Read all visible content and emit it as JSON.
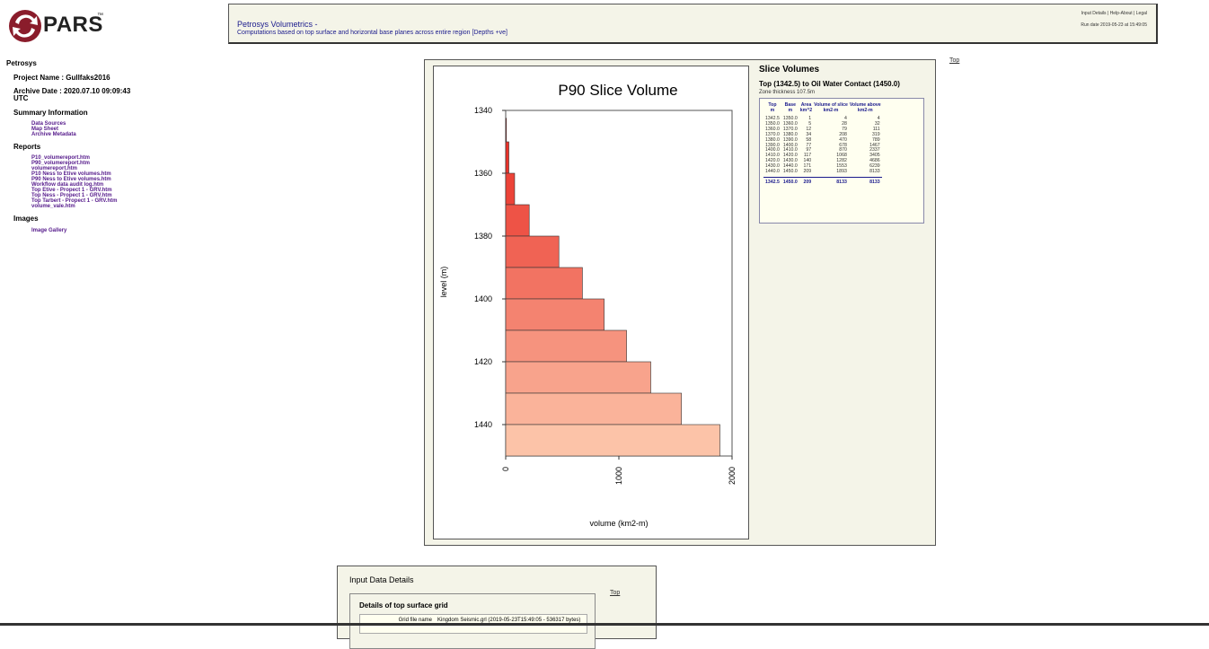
{
  "brand": {
    "name": "PARS",
    "tm": "™"
  },
  "sidebar": {
    "section_title": "Petrosys",
    "project_line": "Project Name : Gullfaks2016",
    "archive_line": "Archive Date : 2020.07.10 09:09:43",
    "archive_tz": "UTC",
    "summary_heading": "Summary Information",
    "summary_links": [
      "Data Sources",
      "Map Sheet",
      "Archive Metadata"
    ],
    "report_heading": "Reports",
    "report_links": [
      "P10_volumereport.htm",
      "P90_volumereport.htm",
      "volumereport.htm",
      "P10 Ness to Etive volumes.htm",
      "P90 Ness to Etive volumes.htm",
      "Workflow data audit log.htm",
      "Top Etive - Propect 1 - GRV.htm",
      "Top Ness - Propect 1 - GRV.htm",
      "Top Tarbert - Propect 1 - GRV.htm",
      "volume_vale.htm"
    ],
    "images_heading": "Images",
    "image_links": [
      "Image Gallery"
    ]
  },
  "header": {
    "title": "Petrosys Volumetrics -",
    "subtitle": "Computations based on top surface and horizontal base planes across entire region [Depths +ve]",
    "link_input": "Input Details",
    "link_help": "Help-About",
    "link_legal": "Legal",
    "sep": "|",
    "run_date": "Run date 2019-05-23 at 15:49:05"
  },
  "top_link": "Top",
  "slice_volumes": {
    "title": "Slice Volumes",
    "subtitle": "Top (1342.5) to Oil Water Contact (1450.0)",
    "thickness": "Zone thickness 107.5m",
    "columns": [
      {
        "name": "Top",
        "unit": "m"
      },
      {
        "name": "Base",
        "unit": "m"
      },
      {
        "name": "Area",
        "unit": "km^2"
      },
      {
        "name": "Volume of slice",
        "unit": "km2-m"
      },
      {
        "name": "Volume above",
        "unit": "km2-m"
      }
    ],
    "rows": [
      [
        "1342.5",
        "1350.0",
        "1",
        "4",
        "4"
      ],
      [
        "1350.0",
        "1360.0",
        "5",
        "28",
        "32"
      ],
      [
        "1360.0",
        "1370.0",
        "12",
        "79",
        "111"
      ],
      [
        "1370.0",
        "1380.0",
        "34",
        "208",
        "319"
      ],
      [
        "1380.0",
        "1390.0",
        "58",
        "470",
        "789"
      ],
      [
        "1390.0",
        "1400.0",
        "77",
        "678",
        "1467"
      ],
      [
        "1400.0",
        "1410.0",
        "97",
        "870",
        "2337"
      ],
      [
        "1410.0",
        "1420.0",
        "117",
        "1068",
        "3405"
      ],
      [
        "1420.0",
        "1430.0",
        "140",
        "1282",
        "4686"
      ],
      [
        "1430.0",
        "1440.0",
        "171",
        "1553",
        "6239"
      ],
      [
        "1440.0",
        "1450.0",
        "209",
        "1893",
        "8133"
      ]
    ],
    "total": [
      "1342.5",
      "1450.0",
      "209",
      "8133",
      "8133"
    ]
  },
  "chart_data": {
    "type": "bar",
    "orientation": "horizontal",
    "title": "P90 Slice Volume",
    "xlabel": "volume (km2-m)",
    "ylabel": "level (m)",
    "xlim": [
      0,
      2000
    ],
    "ylim": [
      1340,
      1450
    ],
    "y_inverted": true,
    "xticks": [
      0,
      1000,
      2000
    ],
    "yticks": [
      1340,
      1360,
      1380,
      1400,
      1420,
      1440
    ],
    "bars": [
      {
        "top": 1342.5,
        "base": 1350,
        "value": 4
      },
      {
        "top": 1350,
        "base": 1360,
        "value": 28
      },
      {
        "top": 1360,
        "base": 1370,
        "value": 79
      },
      {
        "top": 1370,
        "base": 1380,
        "value": 208
      },
      {
        "top": 1380,
        "base": 1390,
        "value": 470
      },
      {
        "top": 1390,
        "base": 1400,
        "value": 678
      },
      {
        "top": 1400,
        "base": 1410,
        "value": 870
      },
      {
        "top": 1410,
        "base": 1420,
        "value": 1068
      },
      {
        "top": 1420,
        "base": 1430,
        "value": 1282
      },
      {
        "top": 1430,
        "base": 1440,
        "value": 1553
      },
      {
        "top": 1440,
        "base": 1450,
        "value": 1893
      }
    ],
    "color_top": "#e8231c",
    "color_bottom": "#fcc3a8"
  },
  "input_data": {
    "title": "Input Data Details",
    "inner_title": "Details of top surface grid",
    "row_label": "Grid file name",
    "row_value": "Kingdom Seismic.grl (2019-05-23T15:49:05 - 536317 bytes)",
    "top_link": "Top"
  }
}
